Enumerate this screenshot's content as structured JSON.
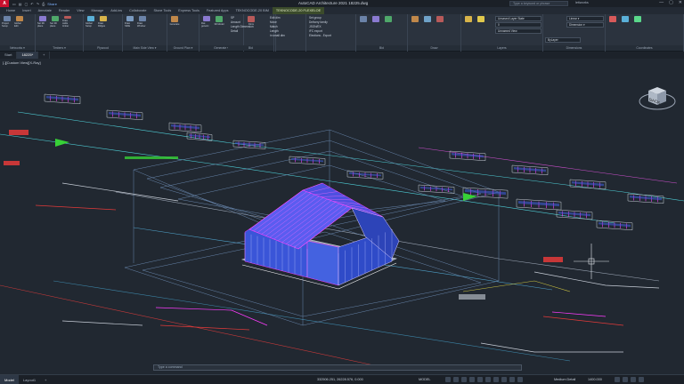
{
  "titlebar": {
    "logo": "A",
    "qat": [
      "▭",
      "▤",
      "▢",
      "↶",
      "↷",
      "⎙"
    ],
    "share": "Share",
    "title": "AutoCAD Architecture 2021   18225.dwg",
    "search_placeholder": "Type a keyword or phrase",
    "user": "letiworks",
    "min": "—",
    "max": "▢",
    "close": "✕"
  },
  "ribbon_tabs": [
    {
      "label": "Home",
      "state": "normal"
    },
    {
      "label": "Insert",
      "state": "normal"
    },
    {
      "label": "Annotate",
      "state": "normal"
    },
    {
      "label": "Render",
      "state": "normal"
    },
    {
      "label": "View",
      "state": "normal"
    },
    {
      "label": "Manage",
      "state": "normal"
    },
    {
      "label": "Add-ins",
      "state": "normal"
    },
    {
      "label": "Collaborate",
      "state": "normal"
    },
    {
      "label": "Stone Tools",
      "state": "normal"
    },
    {
      "label": "Express Tools",
      "state": "normal"
    },
    {
      "label": "Featured Apps",
      "state": "normal"
    },
    {
      "label": "TEKNOCODE-20 BIM",
      "state": "normal"
    },
    {
      "label": "TEKNOCODE-20 FLEXELOE",
      "state": "ctx"
    }
  ],
  "panels": [
    {
      "label": "Networks ▾",
      "tools": [
        "Project Setup",
        "Global Edit"
      ]
    },
    {
      "label": "Timbers ▾",
      "tools": [
        "Set 3D plane",
        "Set 3D plane",
        "Draw cable timber"
      ]
    },
    {
      "label": "Plywood",
      "tools": [
        "Global Setup",
        "Draw Ridges"
      ]
    },
    {
      "label": "Main Side View ▾",
      "tools": [
        "Draw SIDE",
        "Draw Window"
      ]
    },
    {
      "label": "Ground Plan ▾",
      "tools": [
        "Generate"
      ]
    },
    {
      "label": "Generate ▾",
      "tools": [
        "Flat generic",
        "3D Model"
      ]
    },
    {
      "label": "Timber Tools ▾",
      "tools": [
        "Dims"
      ]
    }
  ],
  "ribbon_lists": {
    "dims": [
      "SP",
      "Amount",
      "Length Dimension",
      "Detail"
    ],
    "edit": [
      "Edit dim",
      "Move",
      "Match",
      "Length",
      "in small dim"
    ],
    "export": [
      "Set group",
      "Delivery family",
      "JSON/EX",
      "IFC export",
      "Elections - Export"
    ],
    "groups": [
      "Bid",
      "Tools",
      "Status",
      "Draw",
      "Modify",
      "Layers",
      "Dimensions",
      "Coordinates"
    ]
  },
  "layers": {
    "layer_state": "Unsaved Layer State",
    "current_layer": "0",
    "view": "Unnamed View",
    "by_layer": "ByLayer",
    "dimension_style": "Dimension ▾",
    "linear": "Linear ▾"
  },
  "file_tabs": [
    {
      "label": "Start",
      "active": false
    },
    {
      "label": "18225*",
      "active": true
    },
    {
      "label": "+",
      "active": false
    }
  ],
  "viewport": {
    "label": "[-][Custom View][X-Ray]",
    "viewcube_label": "BACK"
  },
  "command_line": {
    "placeholder": "Type a command"
  },
  "status_bar": {
    "layout_tabs": [
      "Model",
      "Layout1",
      "+"
    ],
    "coordinates": "332506.251, 26228.576, 0.000",
    "model": "MODEL",
    "annotation": "Medium Detail",
    "scale": "1400.000"
  },
  "colors": {
    "roof_blue": "#5b5cf0",
    "wall_blue": "#3f5fe0",
    "frame_magenta": "#ff3cff",
    "outline_cyan": "#4fd0d8",
    "text_green": "#37d137",
    "accent_red": "#e43a3a"
  }
}
